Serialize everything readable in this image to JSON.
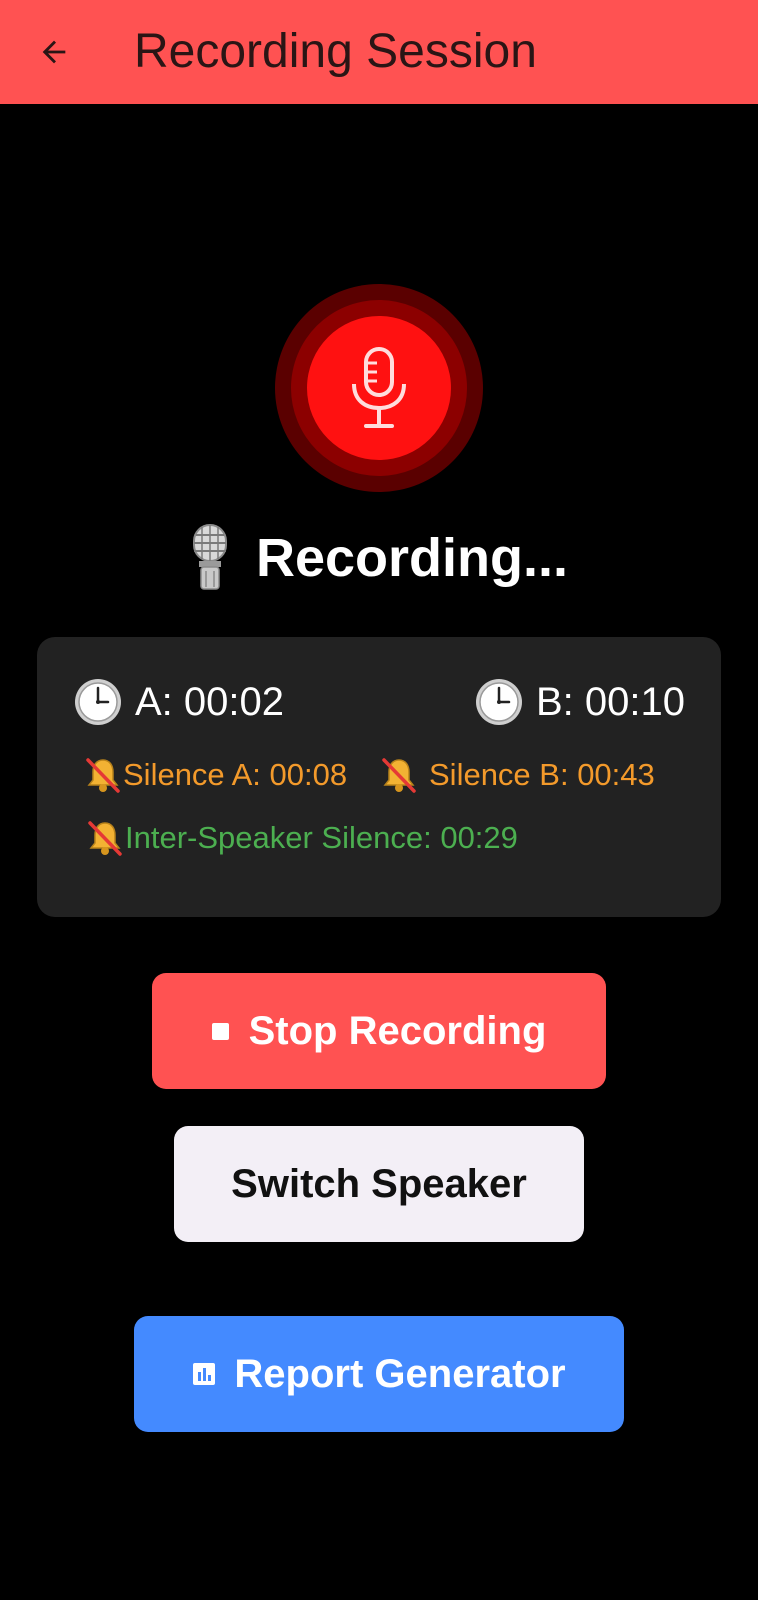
{
  "app_bar": {
    "title": "Recording Session",
    "background": "#FF5252",
    "back_icon": "arrow-left-icon"
  },
  "recorder": {
    "mic_icon": "microphone-icon",
    "status_icon": "studio-microphone-icon",
    "status_text": "Recording...",
    "ring_colors": [
      "#5a0000",
      "#8c0000",
      "#FF1111"
    ]
  },
  "stats": {
    "timer_a": "A: 00:02",
    "timer_b": "B: 00:10",
    "clock_icon": "clock-icon",
    "silence_icon": "muted-bell-icon",
    "silence_a": "Silence A: 00:08",
    "silence_b": "Silence B: 00:43",
    "inter_speaker": "Inter-Speaker Silence: 00:29",
    "silence_color": "#F39A2B",
    "inter_color": "#4CAF50"
  },
  "actions": {
    "stop_label": "Stop Recording",
    "stop_icon": "stop-square-icon",
    "switch_label": "Switch Speaker",
    "report_label": "Report Generator",
    "report_icon": "bar-chart-icon",
    "stop_color": "#FF5252",
    "report_color": "#448AFF"
  }
}
